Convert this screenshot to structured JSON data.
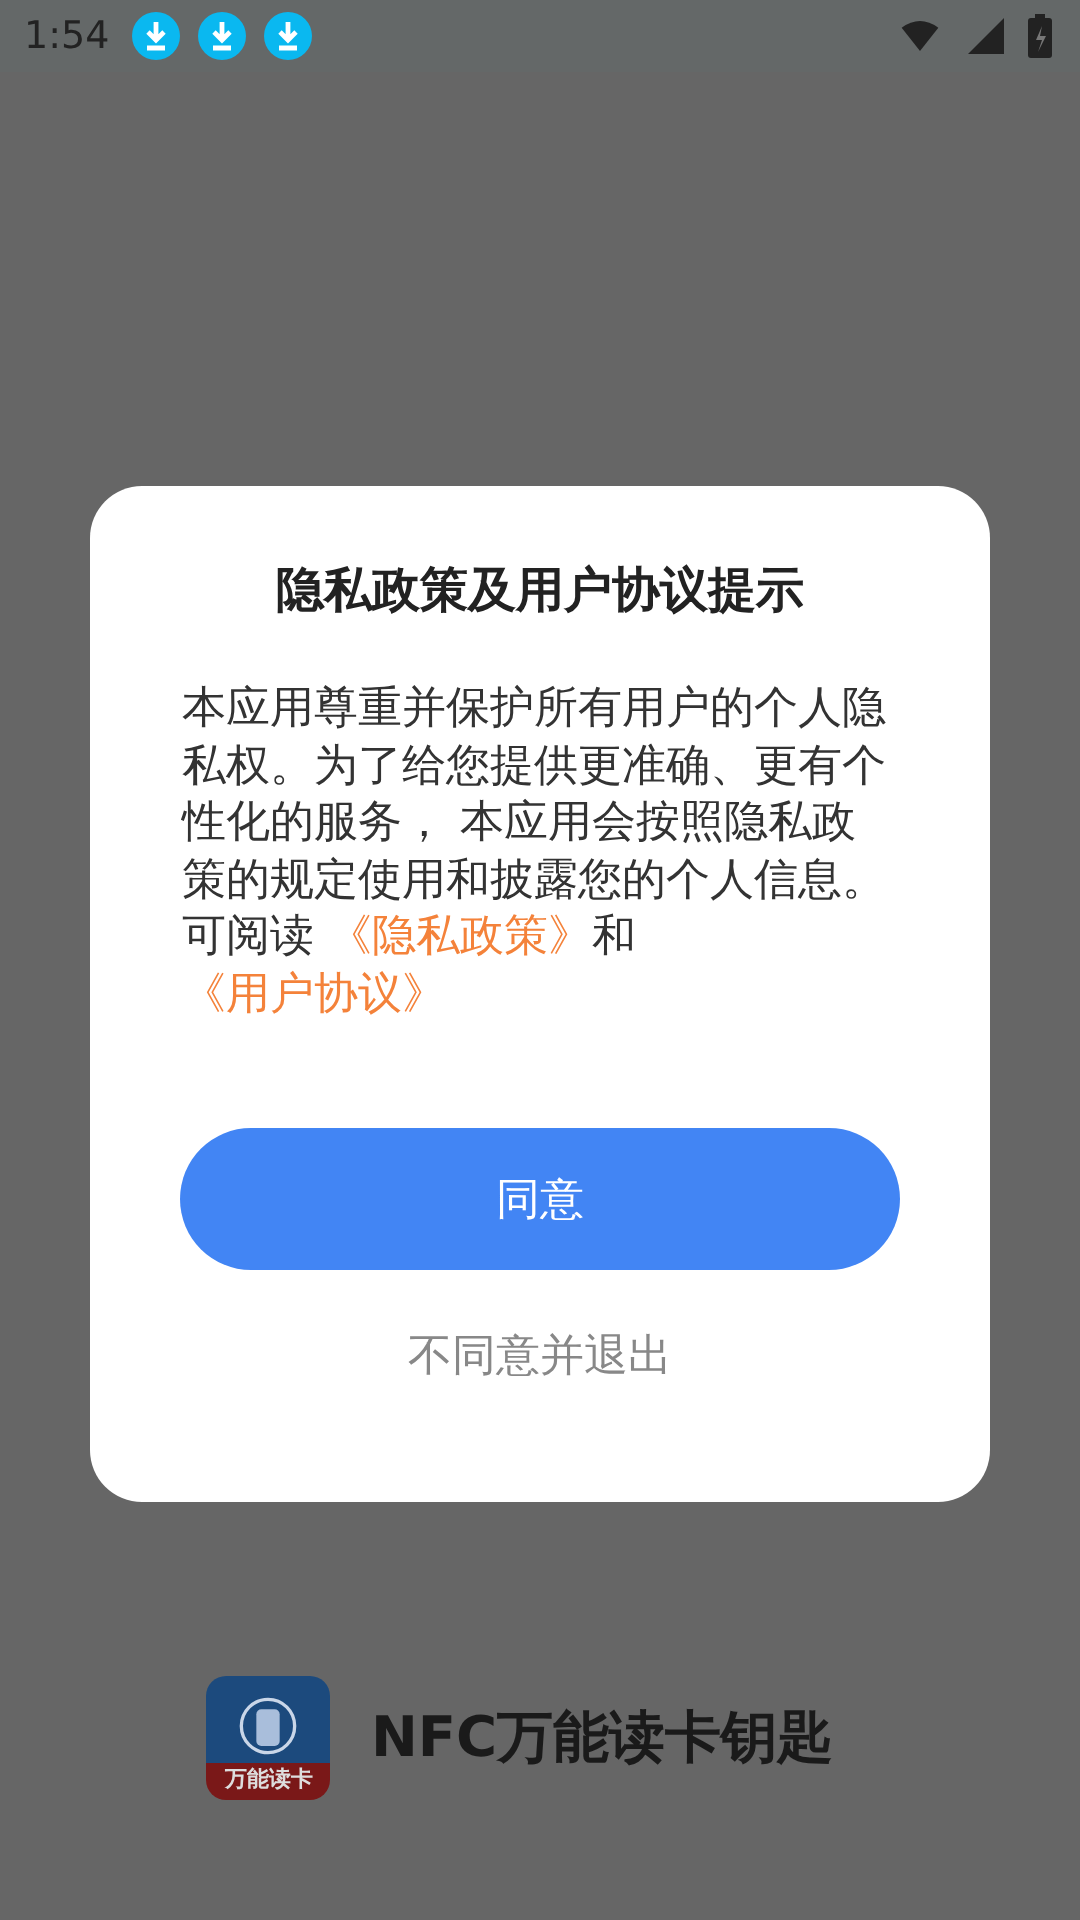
{
  "status_bar": {
    "time": "1:54",
    "notifications": [
      {
        "kind": "download"
      },
      {
        "kind": "download"
      },
      {
        "kind": "download"
      }
    ]
  },
  "background_app": {
    "icon_label": "万能读卡",
    "name": "NFC万能读卡钥匙"
  },
  "dialog": {
    "title": "隐私政策及用户协议提示",
    "body": "本应用尊重并保护所有用户的个人隐私权。为了给您提供更准确、更有个性化的服务， 本应用会按照隐私政策的规定使用和披露您的个人信息。",
    "read_line": [
      {
        "kind": "text",
        "text": "可阅读 "
      },
      {
        "kind": "link",
        "text": "《隐私政策》"
      },
      {
        "kind": "text",
        "text": "和"
      },
      {
        "kind": "link",
        "text": "《用户协议》"
      }
    ],
    "agree_button": "同意",
    "decline_button": "不同意并退出"
  }
}
